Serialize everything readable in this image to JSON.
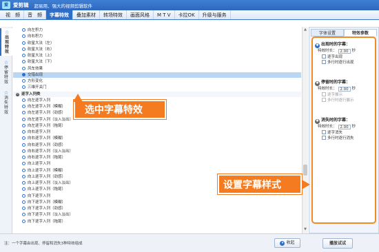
{
  "titlebar": {
    "app_name": "爱剪辑",
    "slogan": "超易用、强大的视频剪辑软件",
    "logo_text": "爱"
  },
  "menu": [
    "视　频",
    "音　频",
    "字幕特效",
    "叠加素材",
    "转场特效",
    "画面风格",
    "M T V",
    "卡拉OK",
    "升级与服务"
  ],
  "vtabs": [
    {
      "label": "出现特效",
      "icon": "star-icon"
    },
    {
      "label": "停留特效",
      "icon": "star-icon"
    },
    {
      "label": "消失特效",
      "icon": "star-icon"
    }
  ],
  "list": [
    {
      "type": "item",
      "label": "向左积力"
    },
    {
      "type": "item",
      "label": "向右积力"
    },
    {
      "type": "item",
      "label": "砍星大法（左）"
    },
    {
      "type": "item",
      "label": "砍星大法（右）"
    },
    {
      "type": "item",
      "label": "砍星大法（上）"
    },
    {
      "type": "item",
      "label": "砍星大法（下）"
    },
    {
      "type": "item",
      "label": "风车效果"
    },
    {
      "type": "item",
      "label": "交错出现",
      "selected": true
    },
    {
      "type": "item",
      "label": "方形变化"
    },
    {
      "type": "item",
      "label": "三维开关门"
    },
    {
      "type": "group",
      "label": "逐字入列类"
    },
    {
      "type": "item",
      "label": "向左逐字入列"
    },
    {
      "type": "item",
      "label": "向左逐字入列（模糊）"
    },
    {
      "type": "item",
      "label": "向左逐字入列（劲感）"
    },
    {
      "type": "item",
      "label": "向左逐字入列（淡入淡出）"
    },
    {
      "type": "item",
      "label": "向左逐字入列（拖尾）"
    },
    {
      "type": "item",
      "label": "向右逐字入列"
    },
    {
      "type": "item",
      "label": "向右逐字入列（模糊）"
    },
    {
      "type": "item",
      "label": "向右逐字入列（劲感）"
    },
    {
      "type": "item",
      "label": "向右逐字入列（淡入淡出）"
    },
    {
      "type": "item",
      "label": "向右逐字入列（拖尾）"
    },
    {
      "type": "item",
      "label": "向上逐字入列"
    },
    {
      "type": "item",
      "label": "向上逐字入列（模糊）"
    },
    {
      "type": "item",
      "label": "向上逐字入列（劲感）"
    },
    {
      "type": "item",
      "label": "向上逐字入列（淡入淡出）"
    },
    {
      "type": "item",
      "label": "向上逐字入列（拖尾）"
    },
    {
      "type": "item",
      "label": "向下逐字入列"
    },
    {
      "type": "item",
      "label": "向下逐字入列（模糊）"
    },
    {
      "type": "item",
      "label": "向下逐字入列（劲感）"
    },
    {
      "type": "item",
      "label": "向下逐字入列（淡入淡出）"
    },
    {
      "type": "item",
      "label": "向下逐字入列（拖尾）"
    }
  ],
  "right_panel": {
    "tabs": [
      "字体设置",
      "特效参数"
    ],
    "appear": {
      "title": "出现时的字幕：",
      "duration_label": "特效时长：",
      "duration": "2.00",
      "unit": "秒",
      "opt1": "逐字出现",
      "opt2": "多行时逐行出现"
    },
    "stay": {
      "title": "停留时的字幕：",
      "duration_label": "特效时长：",
      "duration": "2.00",
      "unit": "秒",
      "opt1": "逐字展示",
      "opt2": "多行时逐行展示"
    },
    "disappear": {
      "title": "消失时的字幕：",
      "duration_label": "特效时长：",
      "duration": "2.00",
      "unit": "秒",
      "opt1": "逐字消失",
      "opt2": "多行时逐行消失"
    }
  },
  "bottom": {
    "note": "注：一个字幕由出现、停留和消失3种特效组成",
    "collapse": "收起",
    "preview": "播放试试"
  },
  "callouts": {
    "select_effect": "选中字幕特效",
    "set_style": "设置字幕样式"
  }
}
